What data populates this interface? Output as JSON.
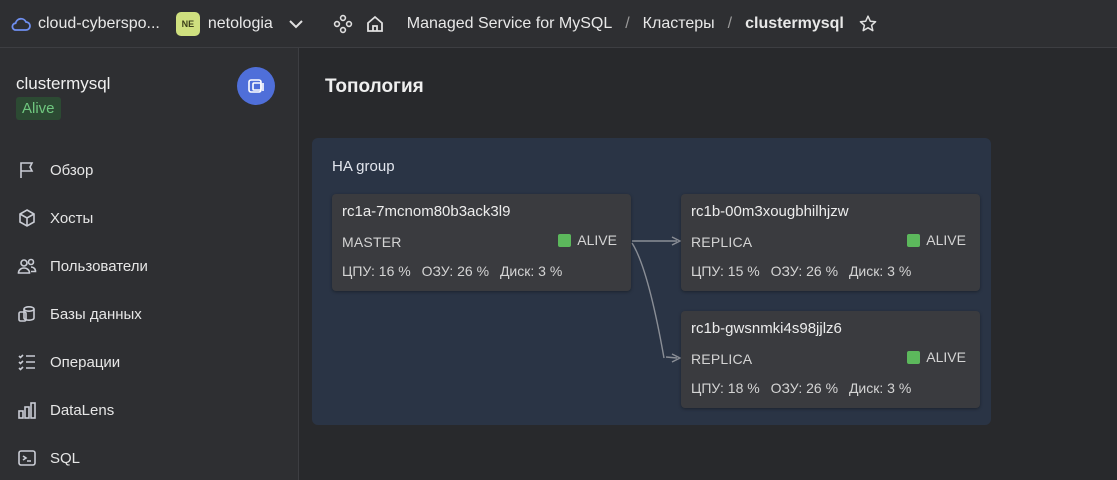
{
  "topbar": {
    "cloud_label": "cloud-cyberspo...",
    "org_initials": "NE",
    "org_label": "netologia",
    "breadcrumbs": [
      "Managed Service for MySQL",
      "Кластеры",
      "clustermysql"
    ],
    "separator": "/"
  },
  "sidebar": {
    "cluster_name": "clustermysql",
    "status": "Alive",
    "items": [
      {
        "label": "Обзор",
        "icon": "flag-icon"
      },
      {
        "label": "Хосты",
        "icon": "cube-icon"
      },
      {
        "label": "Пользователи",
        "icon": "users-icon"
      },
      {
        "label": "Базы данных",
        "icon": "databases-icon"
      },
      {
        "label": "Операции",
        "icon": "operations-list-icon"
      },
      {
        "label": "DataLens",
        "icon": "chart-bars-icon"
      },
      {
        "label": "SQL",
        "icon": "terminal-icon"
      }
    ]
  },
  "main": {
    "title": "Топология",
    "group_title": "HA group",
    "hosts": [
      {
        "name": "rc1a-7mcnom80b3ack3l9",
        "role": "MASTER",
        "status": "ALIVE",
        "cpu": "ЦПУ: 16 %",
        "ram": "ОЗУ: 26 %",
        "disk": "Диск: 3 %"
      },
      {
        "name": "rc1b-00m3xougbhilhjzw",
        "role": "REPLICA",
        "status": "ALIVE",
        "cpu": "ЦПУ: 15 %",
        "ram": "ОЗУ: 26 %",
        "disk": "Диск: 3 %"
      },
      {
        "name": "rc1b-gwsnmki4s98jjlz6",
        "role": "REPLICA",
        "status": "ALIVE",
        "cpu": "ЦПУ: 18 %",
        "ram": "ОЗУ: 26 %",
        "disk": "Диск: 3 %"
      }
    ]
  },
  "colors": {
    "accent": "#4f6fd9",
    "alive": "#5cb85c",
    "group_bg": "#2a3445"
  }
}
